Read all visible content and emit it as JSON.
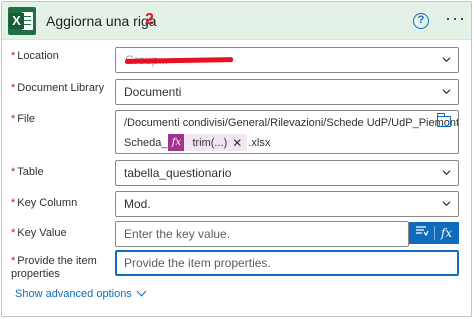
{
  "header": {
    "title": "Aggiorna una riga",
    "step_number": "2",
    "app_icon": "excel-icon",
    "help_icon": "help-icon",
    "more_icon": "more-options-icon"
  },
  "fields": {
    "location": {
      "label": "Location",
      "required": "*",
      "value": "Group...",
      "redacted": true
    },
    "document_library": {
      "label": "Document Library",
      "required": "*",
      "value": "Documenti"
    },
    "file": {
      "label": "File",
      "required": "*",
      "value_line1": "/Documenti condivisi/General/Rilevazioni/Schede UdP/UdP_Piemonte -",
      "value_prefix": "Scheda_",
      "token_label": "trim(...)",
      "token_icon": "fx",
      "value_suffix": ".xlsx"
    },
    "table": {
      "label": "Table",
      "required": "*",
      "value": "tabella_questionario"
    },
    "key_column": {
      "label": "Key Column",
      "required": "*",
      "value": "Mod."
    },
    "key_value": {
      "label": "Key Value",
      "required": "*",
      "placeholder": "Enter the key value."
    },
    "item_properties": {
      "label_line1": "Provide the item",
      "label_line2": "properties",
      "required": "*",
      "placeholder": "Provide the item properties."
    }
  },
  "dynamic_content": {
    "content_icon": "dynamic-content-icon",
    "expression_icon": "fx"
  },
  "advanced": {
    "label": "Show advanced options"
  },
  "colors": {
    "accent": "#0f6cbd",
    "header_bg": "#e4f1e7",
    "excel_green": "#1e7145",
    "required": "#a4262c",
    "annotation_red": "#e81123",
    "token_bg": "#f3e6f3",
    "token_icon_bg": "#a0338f"
  }
}
